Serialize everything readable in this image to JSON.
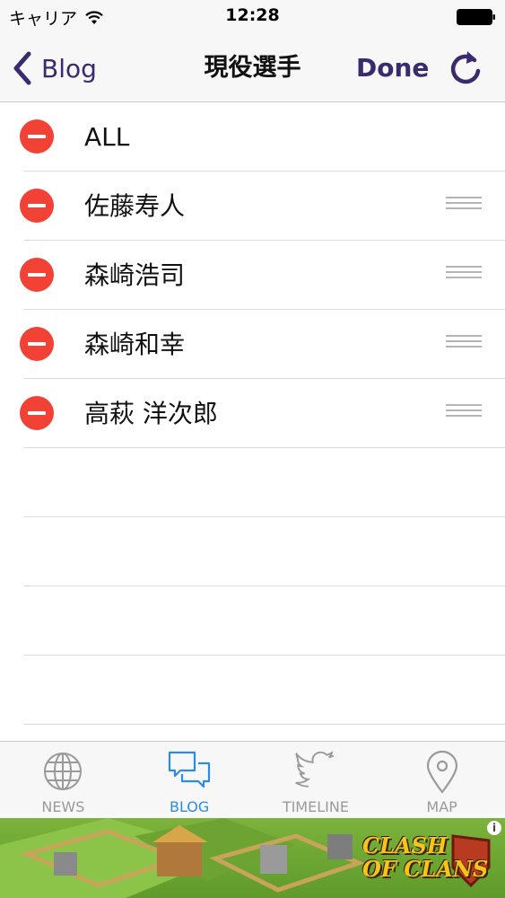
{
  "status_bar": {
    "carrier": "キャリア",
    "time": "12:28"
  },
  "nav": {
    "back_label": "Blog",
    "title": "現役選手",
    "done_label": "Done",
    "refresh_icon": "refresh-icon"
  },
  "list": {
    "items": [
      {
        "label": "ALL",
        "reorderable": false
      },
      {
        "label": "佐藤寿人",
        "reorderable": true
      },
      {
        "label": "森崎浩司",
        "reorderable": true
      },
      {
        "label": "森崎和幸",
        "reorderable": true
      },
      {
        "label": "高萩 洋次郎",
        "reorderable": true
      }
    ]
  },
  "tabs": [
    {
      "label": "NEWS",
      "icon": "globe-icon",
      "active": false
    },
    {
      "label": "BLOG",
      "icon": "chat-bubbles-icon",
      "active": true
    },
    {
      "label": "TIMELINE",
      "icon": "twitter-bird-icon",
      "active": false
    },
    {
      "label": "MAP",
      "icon": "map-pin-icon",
      "active": false
    }
  ],
  "ad": {
    "brand_line1": "CLASH",
    "brand_line2": "OF CLANS"
  },
  "colors": {
    "accent": "#3b2a6e",
    "delete": "#f24135",
    "tab_active": "#2d8ce0",
    "tab_inactive": "#9a9a9a"
  }
}
